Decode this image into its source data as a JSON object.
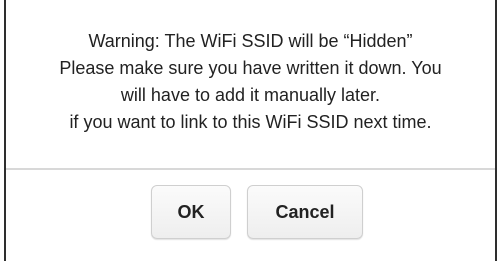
{
  "dialog": {
    "message_lines": [
      "Warning: The WiFi SSID will be “Hidden”",
      "Please make sure you have written it down. You",
      "will have to add it manually later.",
      "if you want to link to this WiFi SSID next time."
    ],
    "buttons": {
      "ok_label": "OK",
      "cancel_label": "Cancel"
    }
  },
  "colors": {
    "border": "#2e2e2e",
    "divider": "#d8d8d8",
    "button_border": "#cfcfcf",
    "text": "#222222"
  }
}
